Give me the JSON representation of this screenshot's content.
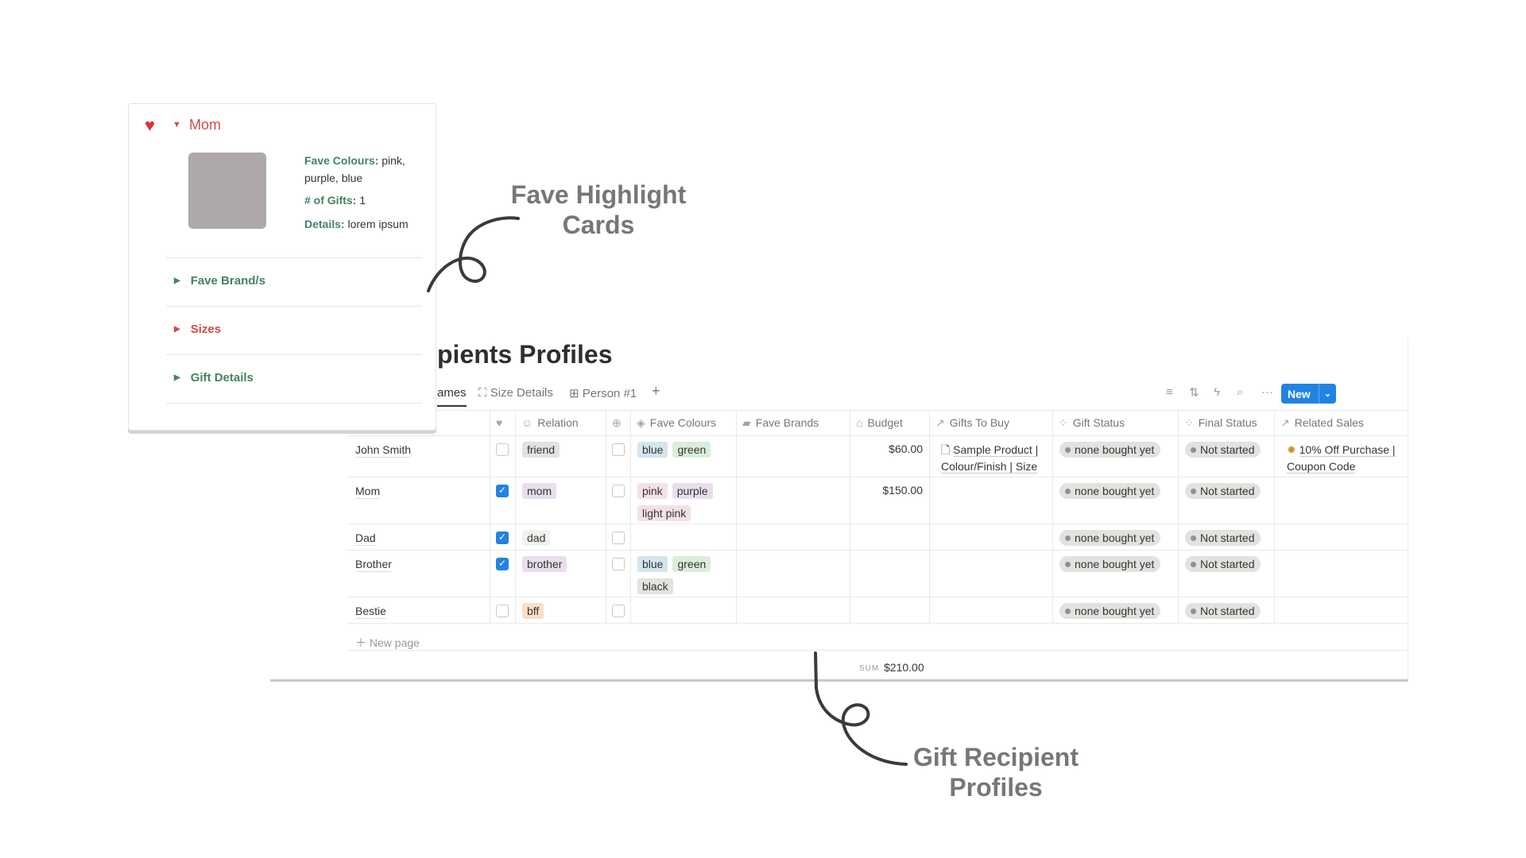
{
  "annotations": {
    "fave_cards": "Fave Highlight Cards",
    "recipient_profiles": "Gift Recipient Profiles"
  },
  "card": {
    "icon": "heart-icon",
    "title": "Mom",
    "title_color": "#d44c47",
    "fave_colours_label": "Fave Colours:",
    "fave_colours_value": "pink,",
    "fave_colours_value2": "purple, blue",
    "gifts_label": "# of Gifts:",
    "gifts_value": "1",
    "details_label": "Details:",
    "details_value": "lorem ipsum",
    "toggles": [
      {
        "label": "Fave Brand/s",
        "color": "#448361"
      },
      {
        "label": "Sizes",
        "color": "#d44c47"
      },
      {
        "label": "Gift Details",
        "color": "#448361"
      }
    ]
  },
  "database": {
    "title": "pients Profiles",
    "tabs": [
      {
        "label": "ames",
        "active": true
      },
      {
        "label": "Size Details",
        "icon": "crop-icon"
      },
      {
        "label": "Person #1",
        "icon": "table-icon"
      }
    ],
    "add_tab": "+",
    "toolbar": {
      "new_label": "New"
    },
    "columns": [
      {
        "label": "",
        "icon": "heart-icon"
      },
      {
        "label": "Relation",
        "icon": "smiley-icon"
      },
      {
        "label": "",
        "icon": "first-aid-icon"
      },
      {
        "label": "Fave Colours",
        "icon": "paint-bucket-icon"
      },
      {
        "label": "Fave Brands",
        "icon": "shopping-bag-icon"
      },
      {
        "label": "Budget",
        "icon": "bank-icon"
      },
      {
        "label": "Gifts To Buy",
        "icon": "relation-arrow-icon"
      },
      {
        "label": "Gift Status",
        "icon": "status-icon"
      },
      {
        "label": "Final Status",
        "icon": "status-icon"
      },
      {
        "label": "Related Sales",
        "icon": "relation-arrow-icon"
      }
    ],
    "rows": [
      {
        "name": "John Smith",
        "fav": false,
        "relation": "friend",
        "check2": false,
        "colours": [
          "blue",
          "green"
        ],
        "budget": "$60.00",
        "gifts": [
          "Sample Product |",
          "Colour/Finish | Size"
        ],
        "gift_status": "none bought yet",
        "final_status": "Not started",
        "related": [
          "10% Off Purchase |",
          "Coupon Code"
        ]
      },
      {
        "name": "Mom",
        "fav": true,
        "relation": "mom",
        "check2": false,
        "colours": [
          "pink",
          "purple",
          "light pink"
        ],
        "budget": "$150.00",
        "gift_status": "none bought yet",
        "final_status": "Not started"
      },
      {
        "name": "Dad",
        "fav": true,
        "relation": "dad",
        "check2": false,
        "colours": [],
        "gift_status": "none bought yet",
        "final_status": "Not started"
      },
      {
        "name": "Brother",
        "fav": true,
        "relation": "brother",
        "check2": false,
        "colours": [
          "blue",
          "green",
          "black"
        ],
        "gift_status": "none bought yet",
        "final_status": "Not started"
      },
      {
        "name": "Bestie",
        "fav": false,
        "relation": "bff",
        "check2": false,
        "colours": [],
        "gift_status": "none bought yet",
        "final_status": "Not started"
      }
    ],
    "new_page": "New page",
    "sum_label": "SUM",
    "sum_value": "$210.00",
    "tag_colors": {
      "friend": "#e3e2e0",
      "mom": "#e8deee",
      "dad": "#f1f1ef",
      "brother": "#e8deee",
      "bff": "#fadec9",
      "blue": "#d3e5ef",
      "green": "#dbeddb",
      "pink": "#f5e0e9",
      "purple": "#e8deee",
      "light pink": "#f5e0e9",
      "black": "#e3e2e0"
    }
  }
}
